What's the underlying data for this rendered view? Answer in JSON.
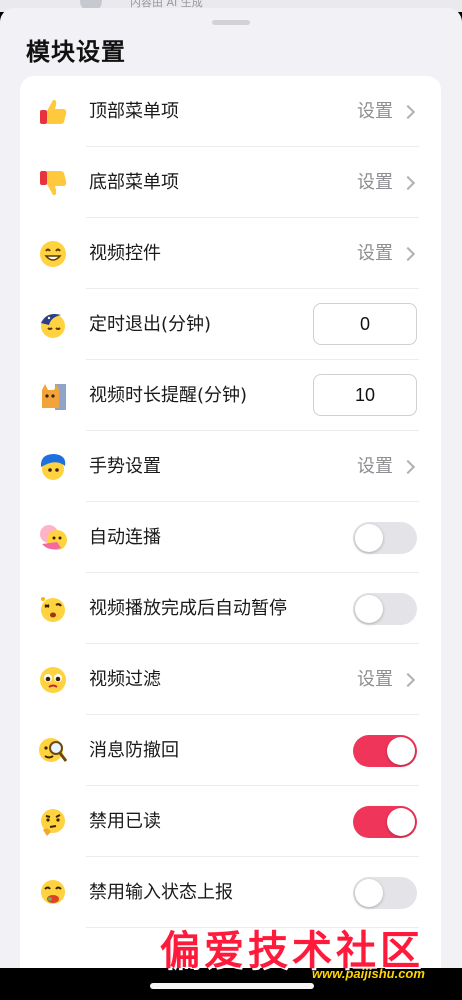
{
  "top_peek": {
    "text": "内容由 AI 生成"
  },
  "sheet": {
    "title": "模块设置"
  },
  "rows": [
    {
      "label": "顶部菜单项",
      "control": "link",
      "action": "设置",
      "icon": "thumbs-up-icon"
    },
    {
      "label": "底部菜单项",
      "control": "link",
      "action": "设置",
      "icon": "thumbs-down-icon"
    },
    {
      "label": "视频控件",
      "control": "link",
      "action": "设置",
      "icon": "grinning-face-icon"
    },
    {
      "label": "定时退出(分钟)",
      "control": "number",
      "value": "0",
      "icon": "moon-sleep-icon"
    },
    {
      "label": "视频时长提醒(分钟)",
      "control": "number",
      "value": "10",
      "icon": "cat-peek-icon"
    },
    {
      "label": "手势设置",
      "control": "link",
      "action": "设置",
      "icon": "blue-hair-face-icon"
    },
    {
      "label": "自动连播",
      "control": "toggle",
      "on": false,
      "icon": "hug-icon"
    },
    {
      "label": "视频播放完成后自动暂停",
      "control": "toggle",
      "on": false,
      "icon": "dizzy-face-icon"
    },
    {
      "label": "视频过滤",
      "control": "link",
      "action": "设置",
      "icon": "pleading-face-icon"
    },
    {
      "label": "消息防撤回",
      "control": "toggle",
      "on": true,
      "icon": "magnifier-face-icon"
    },
    {
      "label": "禁用已读",
      "control": "toggle",
      "on": true,
      "icon": "thinking-face-icon"
    },
    {
      "label": "禁用输入状态上报",
      "control": "toggle",
      "on": false,
      "icon": "eating-face-icon"
    }
  ],
  "watermark": {
    "text": "偏爱技术社区",
    "url": "www.paijishu.com"
  },
  "colors": {
    "toggle_on": "#f0355a",
    "toggle_off": "#e4e4e8",
    "accent_link": "#8e8e93"
  }
}
